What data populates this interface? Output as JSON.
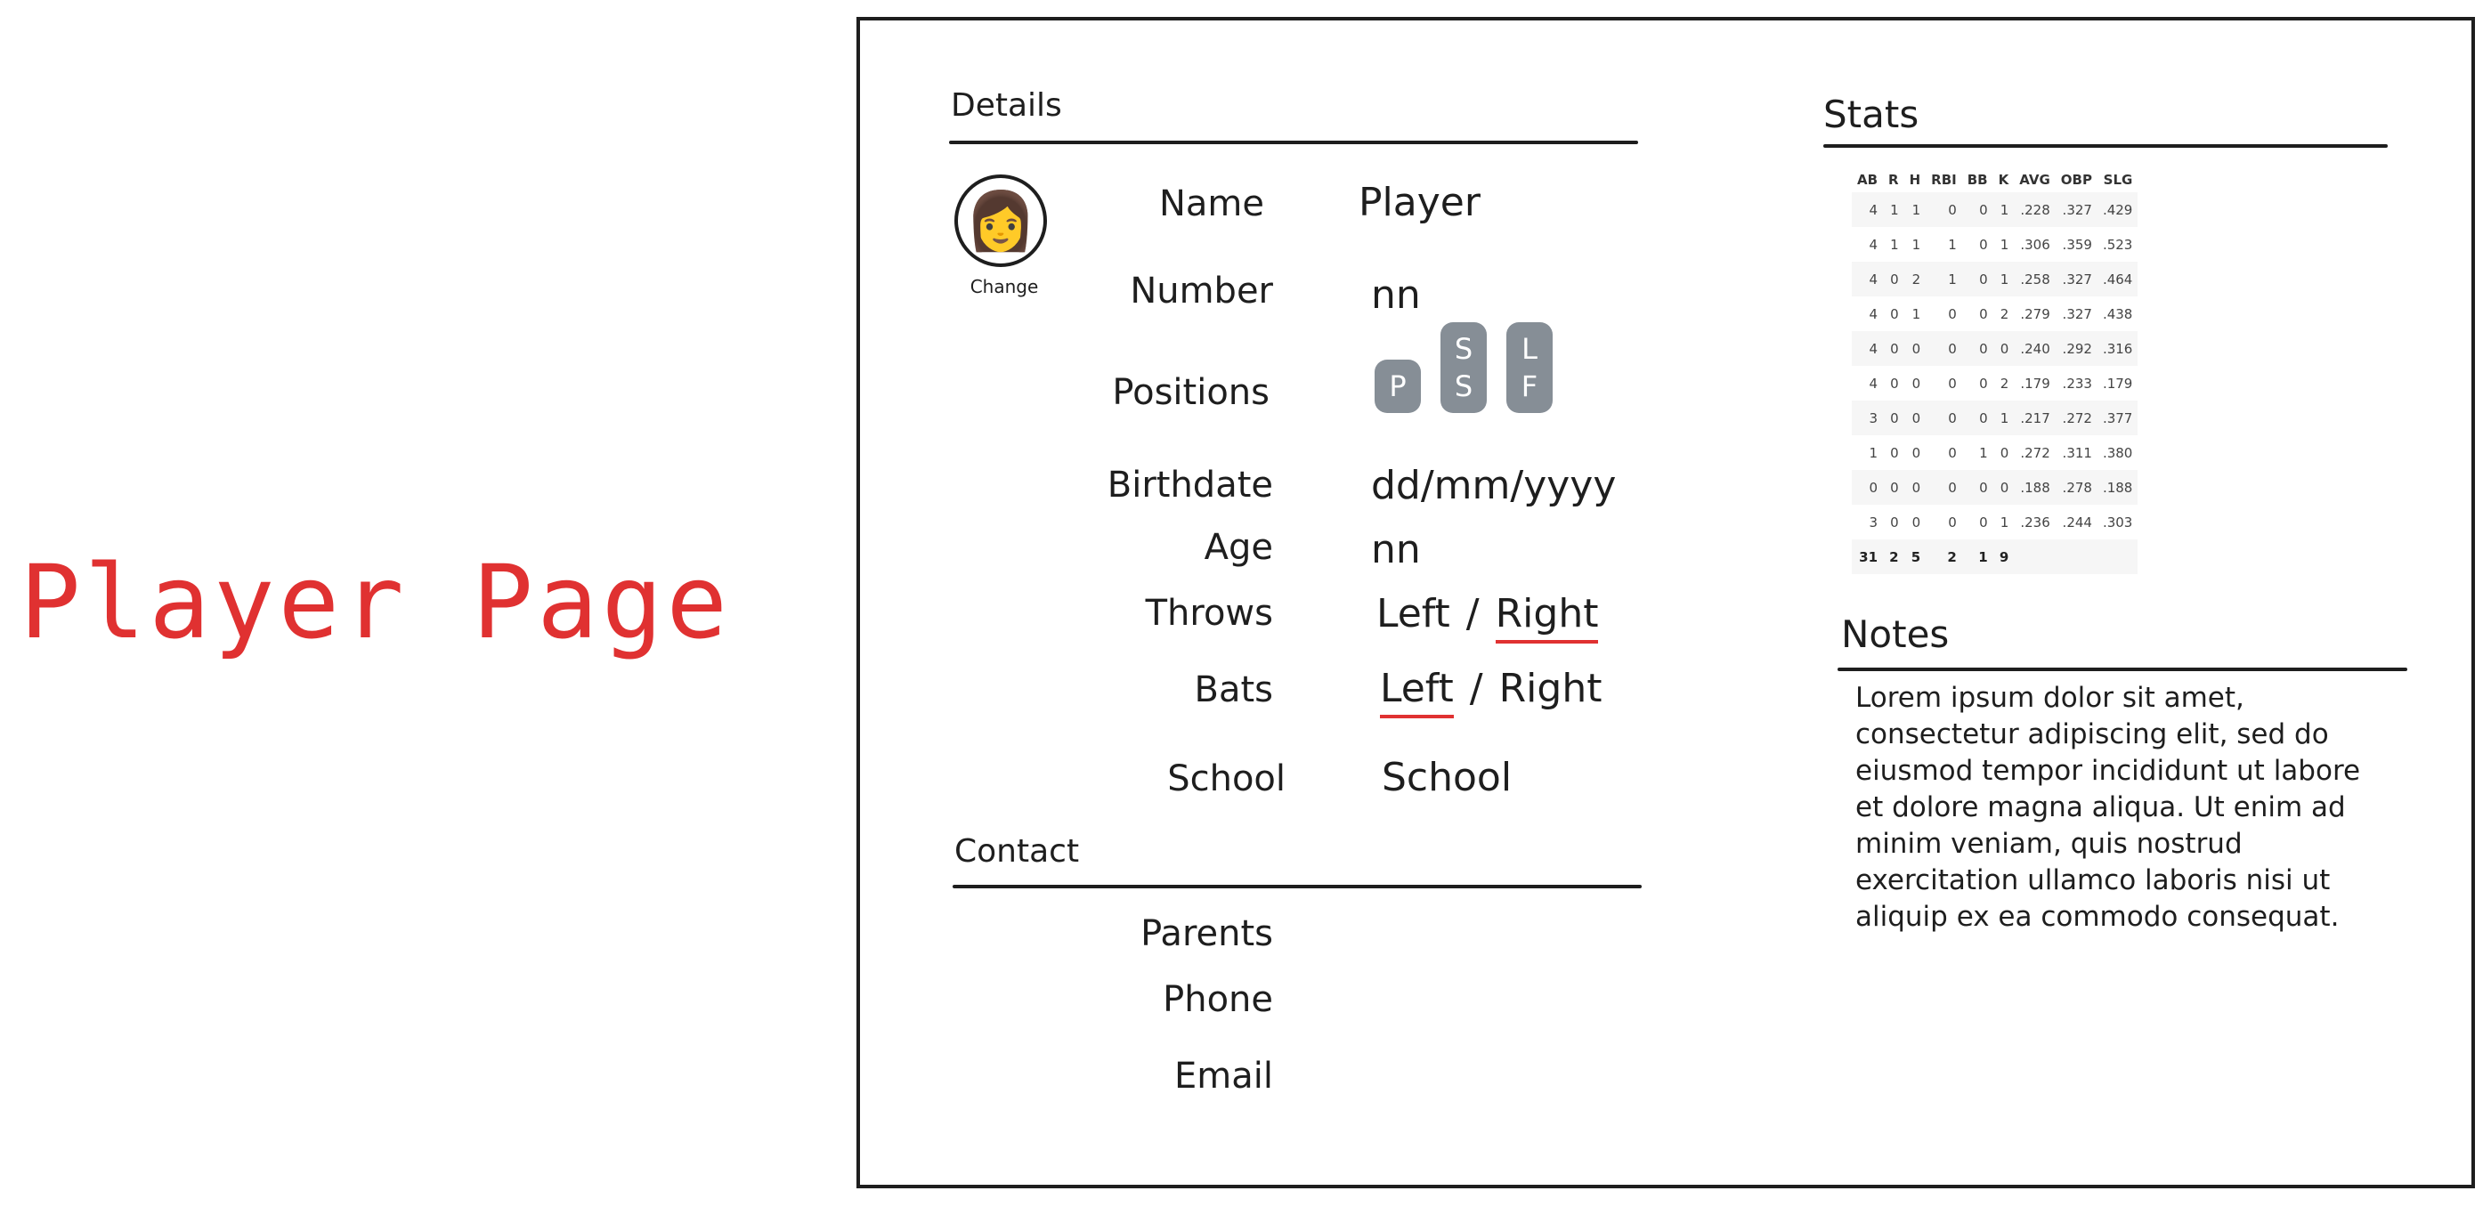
{
  "page_title": "Player Page",
  "details": {
    "heading": "Details",
    "avatar_icon": "person-emoji",
    "avatar_glyph": "👩",
    "change_label": "Change",
    "name_label": "Name",
    "name_value": "Player",
    "number_label": "Number",
    "number_value": "nn",
    "positions_label": "Positions",
    "positions": [
      {
        "line1": "P",
        "line2": ""
      },
      {
        "line1": "S",
        "line2": "S"
      },
      {
        "line1": "L",
        "line2": "F"
      }
    ],
    "birthdate_label": "Birthdate",
    "birthdate_value": "dd/mm/yyyy",
    "age_label": "Age",
    "age_value": "nn",
    "throws_label": "Throws",
    "throws_options": [
      "Left",
      "Right"
    ],
    "throws_selected": "Right",
    "bats_label": "Bats",
    "bats_options": [
      "Left",
      "Right"
    ],
    "bats_selected": "Left",
    "separator": "/",
    "school_label": "School",
    "school_value": "School",
    "selection_color": "#e03131"
  },
  "contact": {
    "heading": "Contact",
    "parents_label": "Parents",
    "phone_label": "Phone",
    "email_label": "Email"
  },
  "stats": {
    "heading": "Stats",
    "columns": [
      "AB",
      "R",
      "H",
      "RBI",
      "BB",
      "K",
      "AVG",
      "OBP",
      "SLG"
    ],
    "rows": [
      [
        "4",
        "1",
        "1",
        "0",
        "0",
        "1",
        ".228",
        ".327",
        ".429"
      ],
      [
        "4",
        "1",
        "1",
        "1",
        "0",
        "1",
        ".306",
        ".359",
        ".523"
      ],
      [
        "4",
        "0",
        "2",
        "1",
        "0",
        "1",
        ".258",
        ".327",
        ".464"
      ],
      [
        "4",
        "0",
        "1",
        "0",
        "0",
        "2",
        ".279",
        ".327",
        ".438"
      ],
      [
        "4",
        "0",
        "0",
        "0",
        "0",
        "0",
        ".240",
        ".292",
        ".316"
      ],
      [
        "4",
        "0",
        "0",
        "0",
        "0",
        "2",
        ".179",
        ".233",
        ".179"
      ],
      [
        "3",
        "0",
        "0",
        "0",
        "0",
        "1",
        ".217",
        ".272",
        ".377"
      ],
      [
        "1",
        "0",
        "0",
        "0",
        "1",
        "0",
        ".272",
        ".311",
        ".380"
      ],
      [
        "0",
        "0",
        "0",
        "0",
        "0",
        "0",
        ".188",
        ".278",
        ".188"
      ],
      [
        "3",
        "0",
        "0",
        "0",
        "0",
        "1",
        ".236",
        ".244",
        ".303"
      ]
    ],
    "totals": [
      "31",
      "2",
      "5",
      "2",
      "1",
      "9",
      "",
      "",
      ""
    ]
  },
  "notes": {
    "heading": "Notes",
    "text": "Lorem ipsum dolor sit amet, consectetur adipiscing elit, sed do eiusmod tempor incididunt ut labore et dolore magna aliqua. Ut enim ad minim veniam, quis nostrud exercitation ullamco laboris nisi ut aliquip ex ea commodo consequat."
  },
  "colors": {
    "title": "#e03131",
    "chip": "#868e96",
    "ink": "#1e1e1e"
  }
}
